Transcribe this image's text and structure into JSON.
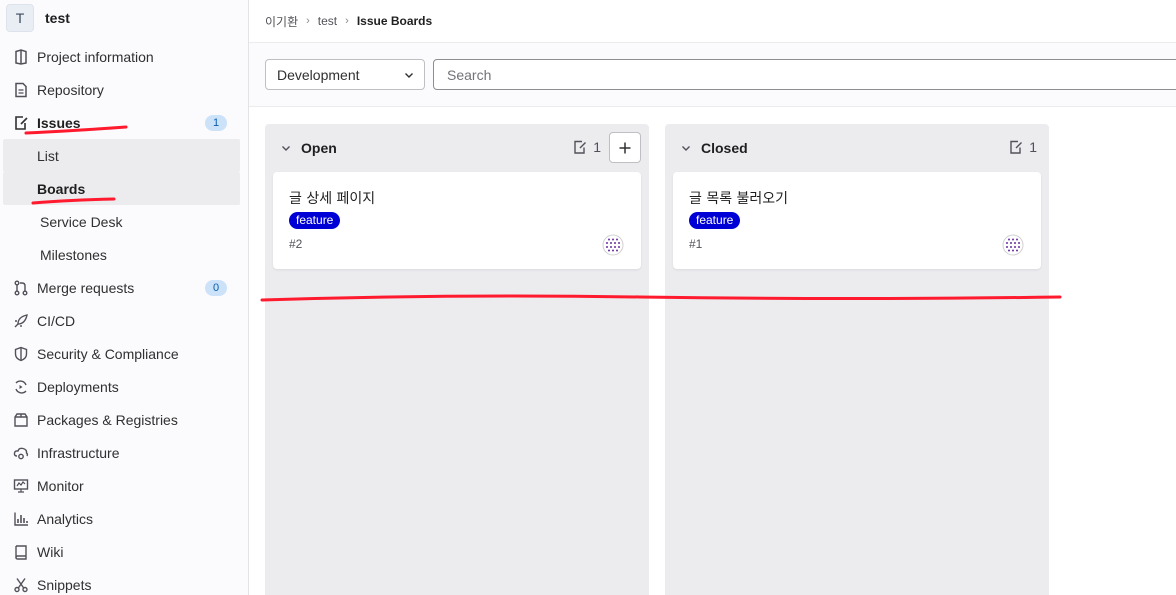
{
  "project": {
    "avatar_letter": "T",
    "name": "test"
  },
  "sidebar": {
    "items": [
      {
        "label": "Project information",
        "icon": "project-info-icon"
      },
      {
        "label": "Repository",
        "icon": "repository-icon"
      },
      {
        "label": "Issues",
        "icon": "issues-icon",
        "badge": "1"
      },
      {
        "label": "Merge requests",
        "icon": "merge-request-icon",
        "badge": "0"
      },
      {
        "label": "CI/CD",
        "icon": "rocket-icon"
      },
      {
        "label": "Security & Compliance",
        "icon": "shield-icon"
      },
      {
        "label": "Deployments",
        "icon": "deployments-icon"
      },
      {
        "label": "Packages & Registries",
        "icon": "package-icon"
      },
      {
        "label": "Infrastructure",
        "icon": "cloud-gear-icon"
      },
      {
        "label": "Monitor",
        "icon": "monitor-icon"
      },
      {
        "label": "Analytics",
        "icon": "chart-icon"
      },
      {
        "label": "Wiki",
        "icon": "book-icon"
      },
      {
        "label": "Snippets",
        "icon": "scissors-icon"
      }
    ],
    "issues_sub": [
      "List",
      "Boards",
      "Service Desk",
      "Milestones"
    ]
  },
  "breadcrumb": {
    "group": "이기환",
    "project": "test",
    "current": "Issue Boards"
  },
  "filters": {
    "board_select": "Development",
    "search_placeholder": "Search"
  },
  "board": {
    "lists": [
      {
        "title": "Open",
        "count": "1",
        "cards": [
          {
            "title": "글 상세 페이지",
            "label": "feature",
            "number": "#2"
          }
        ]
      },
      {
        "title": "Closed",
        "count": "1",
        "cards": [
          {
            "title": "글 목록 불러오기",
            "label": "feature",
            "number": "#1"
          }
        ]
      }
    ]
  },
  "colors": {
    "label_feature": "#0000d6",
    "annotation": "#ff1a2e",
    "badge_bg": "#cbe2f9"
  }
}
